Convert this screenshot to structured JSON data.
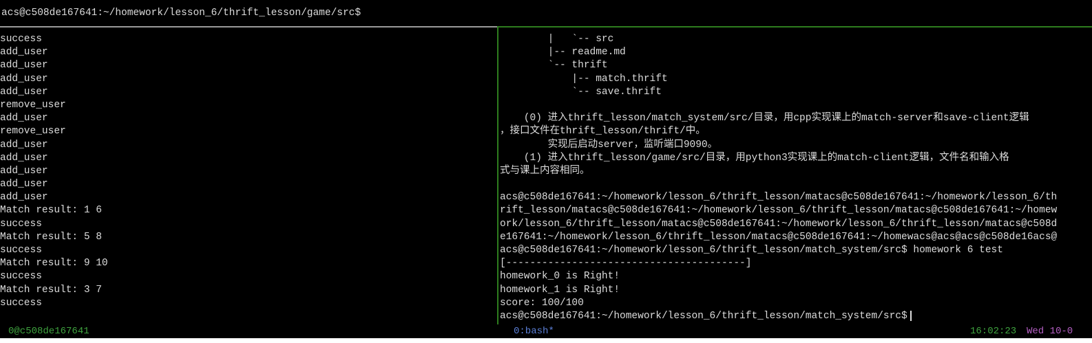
{
  "top_prompt": "acs@c508de167641:~/homework/lesson_6/thrift_lesson/game/src$",
  "left_pane": [
    "success",
    "add_user",
    "add_user",
    "add_user",
    "add_user",
    "remove_user",
    "add_user",
    "remove_user",
    "add_user",
    "add_user",
    "add_user",
    "add_user",
    "add_user",
    "Match result: 1 6",
    "success",
    "Match result: 5 8",
    "success",
    "Match result: 9 10",
    "success",
    "Match result: 3 7",
    "success"
  ],
  "right_pane": [
    "        |   `-- src",
    "        |-- readme.md",
    "        `-- thrift",
    "            |-- match.thrift",
    "            `-- save.thrift",
    "",
    "    (0) 进入thrift_lesson/match_system/src/目录，用cpp实现课上的match-server和save-client逻辑",
    "，接口文件在thrift_lesson/thrift/中。",
    "        实现后启动server，监听端口9090。",
    "    (1) 进入thrift_lesson/game/src/目录，用python3实现课上的match-client逻辑，文件名和输入格",
    "式与课上内容相同。",
    "",
    "acs@c508de167641:~/homework/lesson_6/thrift_lesson/matacs@c508de167641:~/homework/lesson_6/th",
    "rift_lesson/matacs@c508de167641:~/homework/lesson_6/thrift_lesson/matacs@c508de167641:~/homew",
    "ork/lesson_6/thrift_lesson/matacs@c508de167641:~/homework/lesson_6/thrift_lesson/matacs@c508d",
    "e167641:~/homework/lesson_6/thrift_lesson/matacs@c508de167641:~/homewacs@acs@acs@c508de16acs@",
    "acs@c508de167641:~/homework/lesson_6/thrift_lesson/match_system/src$ homework 6 test",
    "[----------------------------------------]",
    "homework_0 is Right!",
    "homework_1 is Right!",
    "score: 100/100",
    "acs@c508de167641:~/homework/lesson_6/thrift_lesson/match_system/src$"
  ],
  "status_bar": {
    "session": "0@c508de167641",
    "window": "0:bash*",
    "time": "16:02:23",
    "date": "Wed 10-0"
  },
  "colors": {
    "background": "#000000",
    "text": "#dcdcdc",
    "pane_border_active": "#2e7d1e",
    "status_green": "#3fa33f",
    "status_blue": "#5b7fd6",
    "status_purple": "#b45fc3"
  },
  "icons": {
    "cursor": "cursor-bar-icon"
  }
}
